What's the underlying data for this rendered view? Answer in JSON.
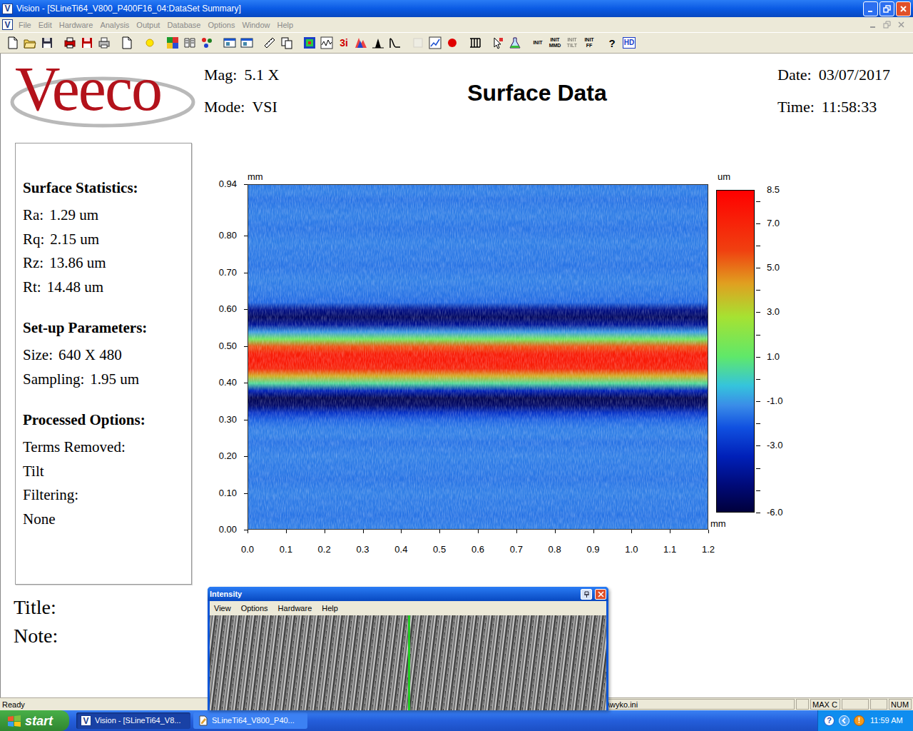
{
  "window": {
    "title": "Vision - [SLineTi64_V800_P400F16_04:DataSet Summary]",
    "app_icon": "V"
  },
  "menu": [
    {
      "label": "File",
      "disabled": true
    },
    {
      "label": "Edit",
      "disabled": true
    },
    {
      "label": "Hardware",
      "disabled": true
    },
    {
      "label": "Analysis",
      "disabled": true
    },
    {
      "label": "Output",
      "disabled": true
    },
    {
      "label": "Database",
      "disabled": true
    },
    {
      "label": "Options",
      "disabled": true
    },
    {
      "label": "Window",
      "disabled": true
    },
    {
      "label": "Help",
      "disabled": true
    }
  ],
  "toolbar": [
    {
      "kind": "page",
      "disabled": false
    },
    {
      "kind": "folder",
      "disabled": false
    },
    {
      "kind": "disk",
      "disabled": false
    },
    {
      "kind": "sep",
      "disabled": false
    },
    {
      "kind": "print-red",
      "disabled": false
    },
    {
      "kind": "disk-red",
      "disabled": false
    },
    {
      "kind": "printer",
      "disabled": false
    },
    {
      "kind": "sep",
      "disabled": false
    },
    {
      "kind": "page",
      "disabled": false
    },
    {
      "kind": "sep",
      "disabled": false
    },
    {
      "kind": "sun",
      "disabled": false
    },
    {
      "kind": "sep",
      "disabled": false
    },
    {
      "kind": "grid",
      "disabled": false
    },
    {
      "kind": "book",
      "disabled": false
    },
    {
      "kind": "dots",
      "disabled": false
    },
    {
      "kind": "sep",
      "disabled": false
    },
    {
      "kind": "window",
      "disabled": false
    },
    {
      "kind": "window",
      "disabled": false
    },
    {
      "kind": "sep",
      "disabled": false
    },
    {
      "kind": "ruler",
      "disabled": false
    },
    {
      "kind": "copy",
      "disabled": false
    },
    {
      "kind": "sep",
      "disabled": false
    },
    {
      "kind": "map",
      "disabled": false
    },
    {
      "kind": "wave",
      "disabled": false
    },
    {
      "kind": "label",
      "label": "3i",
      "disabled": false
    },
    {
      "kind": "spectrum",
      "disabled": false
    },
    {
      "kind": "histogram",
      "disabled": false
    },
    {
      "kind": "curve",
      "disabled": false
    },
    {
      "kind": "sep",
      "disabled": false
    },
    {
      "kind": "box",
      "disabled": true
    },
    {
      "kind": "chart",
      "disabled": false
    },
    {
      "kind": "record",
      "disabled": false
    },
    {
      "kind": "sep",
      "disabled": false
    },
    {
      "kind": "comb",
      "disabled": false
    },
    {
      "kind": "sep",
      "disabled": false
    },
    {
      "kind": "pointer",
      "disabled": false
    },
    {
      "kind": "flask",
      "disabled": false
    },
    {
      "kind": "sep",
      "disabled": false
    },
    {
      "kind": "init",
      "label": "INIT",
      "disabled": false
    },
    {
      "kind": "init",
      "label": "INIT MMD",
      "disabled": false
    },
    {
      "kind": "init",
      "label": "INIT TILT",
      "disabled": true
    },
    {
      "kind": "init",
      "label": "INIT FF",
      "disabled": false
    },
    {
      "kind": "sep",
      "disabled": false
    },
    {
      "kind": "help",
      "label": "?",
      "disabled": false
    },
    {
      "kind": "hd",
      "label": "HD",
      "disabled": false
    }
  ],
  "header": {
    "logo": "Veeco",
    "mag_label": "Mag:",
    "mag": "5.1 X",
    "mode_label": "Mode:",
    "mode": "VSI",
    "title": "Surface Data",
    "date_label": "Date:",
    "date": "03/07/2017",
    "time_label": "Time:",
    "time": "11:58:33"
  },
  "stats_panel": {
    "sections": [
      {
        "heading": "Surface Statistics:",
        "rows": [
          {
            "label": "Ra:",
            "value": "1.29 um"
          },
          {
            "label": "Rq:",
            "value": "2.15 um"
          },
          {
            "label": "Rz:",
            "value": "13.86 um"
          },
          {
            "label": "Rt:",
            "value": "14.48 um"
          }
        ]
      },
      {
        "heading": "Set-up Parameters:",
        "rows": [
          {
            "label": "Size:",
            "value": "640 X 480"
          },
          {
            "label": "Sampling:",
            "value": "1.95 um"
          }
        ]
      },
      {
        "heading": "Processed Options:",
        "rows": [
          {
            "label": "Terms Removed:",
            "value": ""
          },
          {
            "label": "Tilt",
            "value": ""
          },
          {
            "label": "Filtering:",
            "value": ""
          },
          {
            "label": "None",
            "value": ""
          }
        ]
      }
    ]
  },
  "footer_fields": [
    {
      "label": "Title:"
    },
    {
      "label": "Note:"
    }
  ],
  "plot": {
    "y_unit": "mm",
    "x_unit": "mm",
    "y_ticks": [
      "0.94",
      "0.80",
      "0.70",
      "0.60",
      "0.50",
      "0.40",
      "0.30",
      "0.20",
      "0.10",
      "0.00"
    ],
    "x_ticks": [
      "0.0",
      "0.1",
      "0.2",
      "0.3",
      "0.4",
      "0.5",
      "0.6",
      "0.7",
      "0.8",
      "0.9",
      "1.0",
      "1.1",
      "1.2"
    ],
    "height_profile_um": [
      -1.5,
      -1.4,
      -1.6,
      -1.5,
      -1.4,
      -1.5,
      -1.6,
      -1.5,
      -1.4,
      -1.5,
      -1.5,
      -1.6,
      -1.5,
      -1.4,
      -1.5,
      -1.6,
      -1.8,
      -4.5,
      -5.3,
      -4.2,
      -1.0,
      1.5,
      5.5,
      7.3,
      7.5,
      7.0,
      4.0,
      0.5,
      -3.5,
      -5.6,
      -5.1,
      -3.0,
      -1.9,
      -1.5,
      -1.4,
      -1.6,
      -1.5,
      -1.4,
      -1.5,
      -1.5,
      -1.6,
      -1.5,
      -1.4,
      -1.5,
      -1.5,
      -1.6,
      -1.5,
      -1.4
    ]
  },
  "colorbar": {
    "unit": "um",
    "ticks": [
      "8.5",
      "7.0",
      "5.0",
      "3.0",
      "1.0",
      "-1.0",
      "-3.0",
      "-6.0"
    ]
  },
  "intensity_window": {
    "title": "Intensity",
    "menu": [
      "View",
      "Options",
      "Hardware",
      "Help"
    ]
  },
  "status_bar": {
    "message": "Ready",
    "panels": [
      "\\wyko.ini",
      "MAX C",
      "NUM"
    ]
  },
  "taskbar": {
    "start": "start",
    "tasks": [
      {
        "label": "Vision - [SLineTi64_V8...",
        "selected": true
      },
      {
        "label": "SLineTi64_V800_P40...",
        "selected": false
      }
    ],
    "tray": {
      "help": "?",
      "alert": "!",
      "clock": "11:59 AM"
    }
  }
}
